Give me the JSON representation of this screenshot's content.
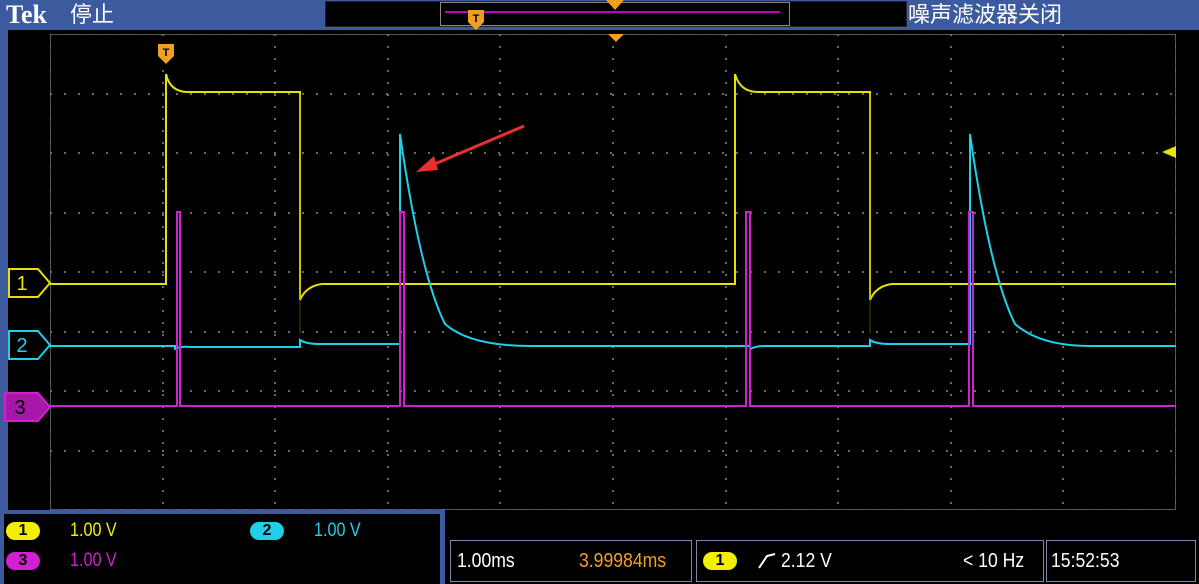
{
  "header": {
    "brand": "Tek",
    "run_state": "停止",
    "noise_filter": "噪声滤波器关闭",
    "trigger_marker": "T"
  },
  "channels": [
    {
      "id": "1",
      "scale": "1.00 V",
      "color": "#f0f000"
    },
    {
      "id": "2",
      "scale": "1.00 V",
      "color": "#20d0e8"
    },
    {
      "id": "3",
      "scale": "1.00 V",
      "color": "#d020d0"
    }
  ],
  "status_bar": {
    "timebase": "1.00ms",
    "trigger_position": "3.99984ms",
    "trigger_channel": "1",
    "trigger_slope_icon": "rising-edge-icon",
    "trigger_level": "2.12 V",
    "frequency": "< 10 Hz",
    "clock": "15:52:53"
  },
  "colors": {
    "frame": "#3b5b9e",
    "trigger_marker": "#f0a020",
    "annotation_arrow": "#e83030"
  }
}
